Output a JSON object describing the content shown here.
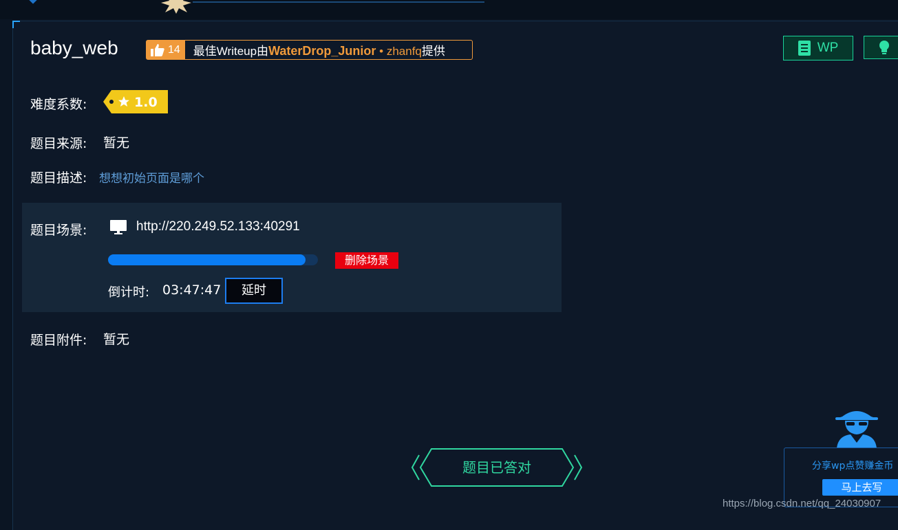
{
  "challenge": {
    "title": "baby_web",
    "likes": "14",
    "writeup_prefix": "最佳Writeup由",
    "writeup_author": "WaterDrop_Junior",
    "writeup_separator": " • ",
    "writeup_contributor": "zhanfq",
    "writeup_suffix": "提供"
  },
  "buttons": {
    "wp_label": "WP",
    "delete_scene": "删除场景",
    "delay": "延时",
    "solved": "题目已答对"
  },
  "fields": {
    "difficulty_label": "难度系数:",
    "difficulty_value": "1.0",
    "source_label": "题目来源:",
    "source_value": "暂无",
    "description_label": "题目描述:",
    "description_value": "想想初始页面是哪个",
    "scene_label": "题目场景:",
    "scene_url": "http://220.249.52.133:40291",
    "countdown_label": "倒计时:",
    "countdown_value": "03:47:47",
    "attachment_label": "题目附件:",
    "attachment_value": "暂无"
  },
  "scene_progress": 0.94,
  "share": {
    "text": "分享wp点赞赚金币",
    "button": "马上去写"
  },
  "watermark": "https://blog.csdn.net/qq_24030907",
  "colors": {
    "background": "#0b1523",
    "accent_orange": "#f09a3b",
    "accent_green": "#1ad49a",
    "progress_blue": "#0a7cf3",
    "danger_red": "#e8000f",
    "link_blue": "#5f9ed9"
  },
  "icons": [
    "thumbs-up-icon",
    "document-icon",
    "lightbulb-icon",
    "star-icon",
    "monitor-icon",
    "spy-icon"
  ]
}
